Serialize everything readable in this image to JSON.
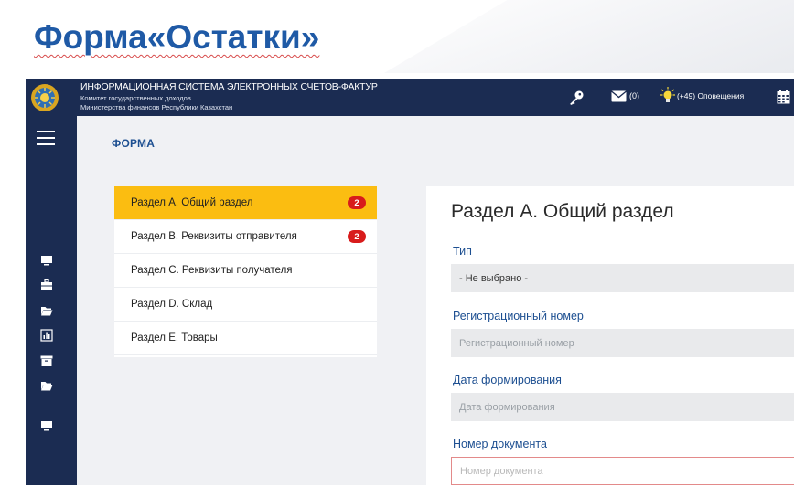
{
  "slide": {
    "title": "Форма«Остатки»"
  },
  "header": {
    "system_title": "ИНФОРМАЦИОННАЯ СИСТЕМА ЭЛЕКТРОННЫХ СЧЕТОВ-ФАКТУР",
    "subtitle_line1": "Комитет государственных доходов",
    "subtitle_line2": "Министерства финансов Республики Казахстан",
    "mail_count": "(0)",
    "notifications": "(+49) Оповещения"
  },
  "page": {
    "section_label": "ФОРМА"
  },
  "menu": {
    "items": [
      {
        "label": "Раздел А. Общий раздел",
        "badge": "2",
        "active": true
      },
      {
        "label": "Раздел B. Реквизиты отправителя",
        "badge": "2",
        "active": false
      },
      {
        "label": "Раздел C. Реквизиты получателя",
        "badge": "",
        "active": false
      },
      {
        "label": "Раздел D. Склад",
        "badge": "",
        "active": false
      },
      {
        "label": "Раздел E. Товары",
        "badge": "",
        "active": false
      }
    ]
  },
  "form": {
    "title": "Раздел А. Общий раздел",
    "type_label": "Тип",
    "type_value": "- Не выбрано -",
    "reg_label": "Регистрационный номер",
    "reg_placeholder": "Регистрационный номер",
    "date_label": "Дата формирования",
    "date_placeholder": "Дата формирования",
    "docnum_label": "Номер документа",
    "docnum_placeholder": "Номер документа"
  },
  "colors": {
    "navy": "#1b2c52",
    "accent_yellow": "#fbbd11",
    "badge_red": "#d81b1b",
    "title_blue": "#1f5aa6"
  },
  "icons": {
    "topbar": [
      "key-icon",
      "mail-icon",
      "bulb-icon",
      "calendar-icon"
    ],
    "sidebar": [
      "menu-icon",
      "monitor-icon",
      "briefcase-icon",
      "folder-icon",
      "chart-icon",
      "archive-icon",
      "folder-icon",
      "monitor-icon"
    ]
  }
}
